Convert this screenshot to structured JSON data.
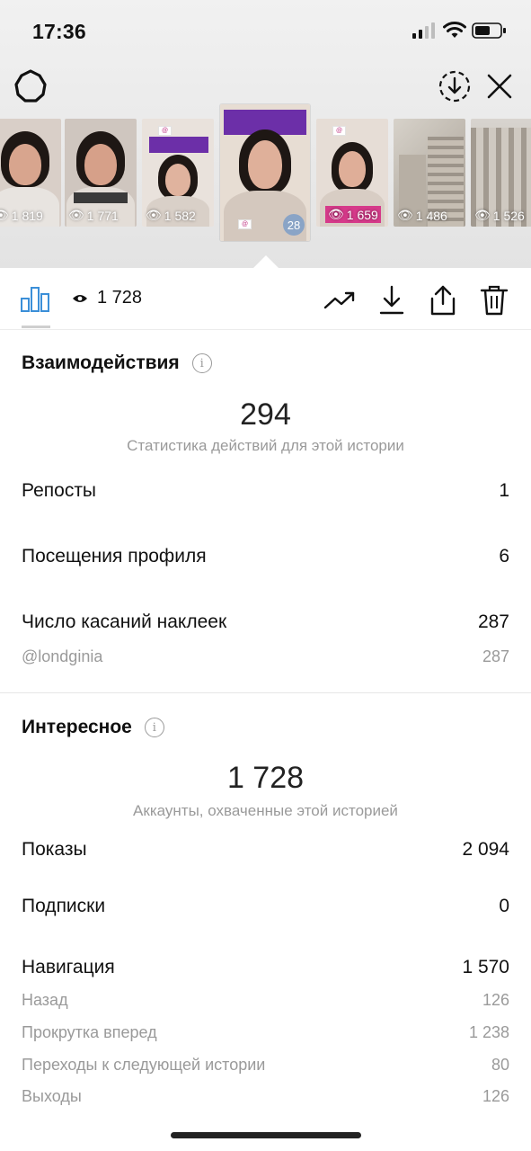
{
  "status_bar": {
    "time": "17:36"
  },
  "thumbnails": [
    {
      "views": "1 819",
      "bg": "#d9cfc8",
      "skin": "#d8a58e",
      "top": "#e8e4e0"
    },
    {
      "views": "1 771",
      "bg": "#cfc6bf",
      "skin": "#d6a089",
      "top": "#3a3a3a"
    },
    {
      "views": "1 582",
      "bg": "#e9e2dc",
      "skin": "#e0b39e",
      "top": "#d9d0c8"
    },
    {
      "views": "",
      "bg": "#e7ddd3",
      "skin": "#dfb09a",
      "top": "#d4c8be",
      "selected_badge": "28"
    },
    {
      "views": "1 659",
      "bg": "#e6ddd6",
      "skin": "#dfae98",
      "top": "#d8cdc4"
    },
    {
      "views": "1 486",
      "bg": "#b9b2a8",
      "skin": "",
      "top": ""
    },
    {
      "views": "1 526",
      "bg": "#c9c4bd",
      "skin": "",
      "top": ""
    }
  ],
  "action_bar": {
    "reach": "1 728"
  },
  "interactions": {
    "title": "Взаимодействия",
    "total": "294",
    "subtitle": "Статистика действий для этой истории",
    "rows": [
      {
        "label": "Репосты",
        "value": "1"
      },
      {
        "label": "Посещения профиля",
        "value": "6"
      },
      {
        "label": "Число касаний наклеек",
        "value": "287"
      }
    ],
    "sticker": {
      "label": "@londginia",
      "value": "287"
    }
  },
  "discovery": {
    "title": "Интересное",
    "total": "1 728",
    "subtitle": "Аккаунты, охваченные этой историей",
    "rows": [
      {
        "label": "Показы",
        "value": "2 094"
      },
      {
        "label": "Подписки",
        "value": "0"
      },
      {
        "label": "Навигация",
        "value": "1 570"
      }
    ],
    "navigation": [
      {
        "label": "Назад",
        "value": "126"
      },
      {
        "label": "Прокрутка вперед",
        "value": "1 238"
      },
      {
        "label": "Переходы к следующей истории",
        "value": "80"
      },
      {
        "label": "Выходы",
        "value": "126"
      }
    ]
  }
}
